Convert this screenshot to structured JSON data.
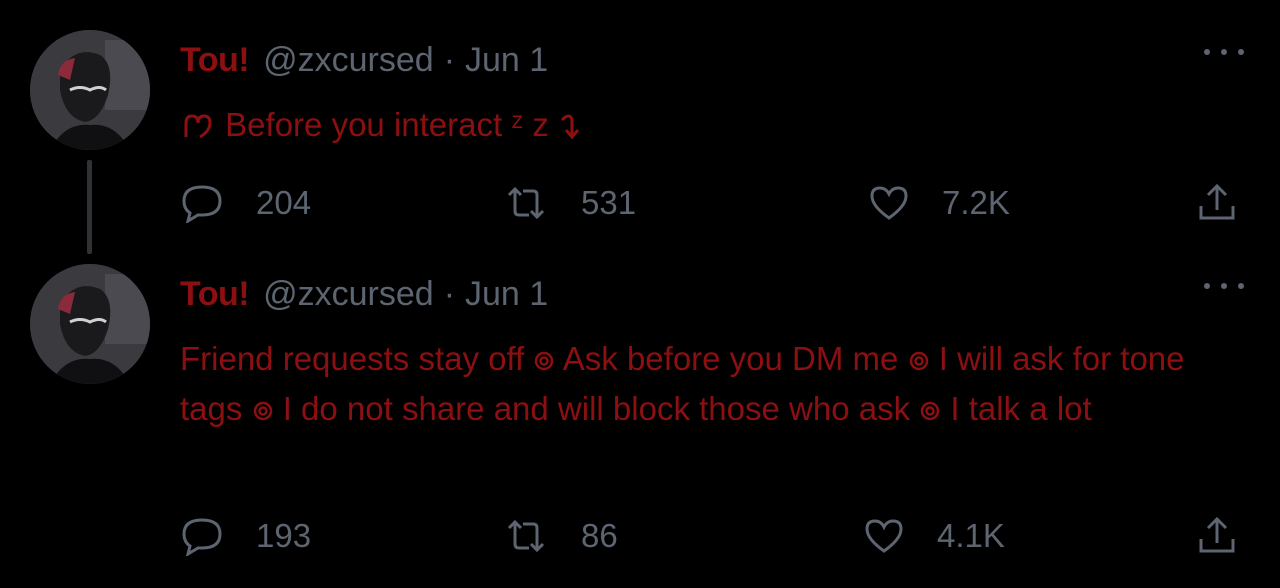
{
  "colors": {
    "background": "#000000",
    "accent": "#8c0f12",
    "muted": "#5c6570"
  },
  "tweets": [
    {
      "name": "Tou!",
      "handle": "@zxcursed",
      "separator": "·",
      "date": "Jun 1",
      "text_prefix_icon": "heart-outline-icon",
      "text": "Before you interact",
      "text_suffix": "ᶻ z",
      "text_suffix_icon": "curl-arrow-icon",
      "reply_count": "204",
      "retweet_count": "531",
      "like_count": "7.2K"
    },
    {
      "name": "Tou!",
      "handle": "@zxcursed",
      "separator": "·",
      "date": "Jun 1",
      "lines": [
        "Friend requests stay off",
        "Ask before you DM me",
        "I will ask for",
        "tone tags",
        "I do not share and will block those who ask",
        "I talk a",
        "lot"
      ],
      "reply_count": "193",
      "retweet_count": "86",
      "like_count": "4.1K"
    }
  ]
}
